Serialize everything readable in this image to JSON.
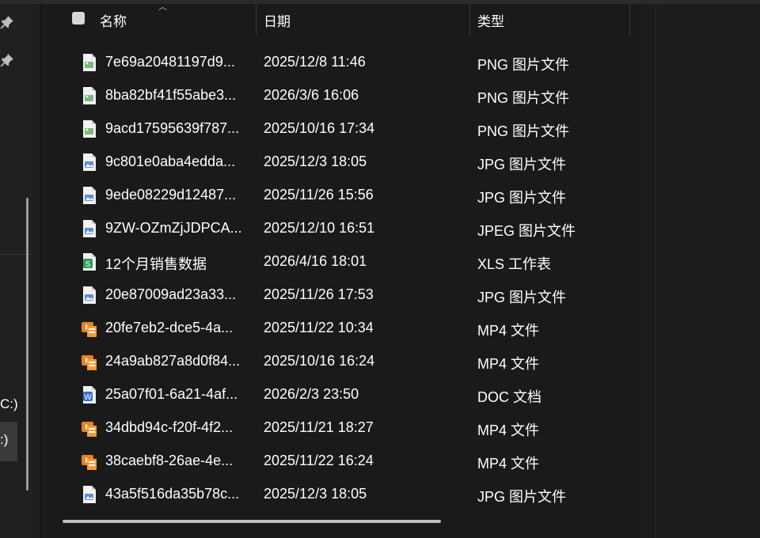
{
  "nav": {
    "pins": [
      "pin-icon",
      "pin-icon"
    ],
    "drives": [
      {
        "label": "C:)"
      },
      {
        "label": ":)"
      }
    ]
  },
  "header": {
    "name": "名称",
    "date": "日期",
    "type": "类型"
  },
  "files": [
    {
      "icon": "png-file-icon",
      "name": "7e69a20481197d9...",
      "date": "2025/12/8 11:46",
      "type": "PNG 图片文件"
    },
    {
      "icon": "png-file-icon",
      "name": "8ba82bf41f55abe3...",
      "date": "2026/3/6 16:06",
      "type": "PNG 图片文件"
    },
    {
      "icon": "png-file-icon",
      "name": "9acd17595639f787...",
      "date": "2025/10/16 17:34",
      "type": "PNG 图片文件"
    },
    {
      "icon": "jpg-file-icon",
      "name": "9c801e0aba4edda...",
      "date": "2025/12/3 18:05",
      "type": "JPG 图片文件"
    },
    {
      "icon": "jpg-file-icon",
      "name": "9ede08229d12487...",
      "date": "2025/11/26 15:56",
      "type": "JPG 图片文件"
    },
    {
      "icon": "jpg-file-icon",
      "name": "9ZW-OZmZjJDPCA...",
      "date": "2025/12/10 16:51",
      "type": "JPEG 图片文件"
    },
    {
      "icon": "xls-file-icon",
      "name": "12个月销售数据",
      "date": "2026/4/16 18:01",
      "type": "XLS 工作表"
    },
    {
      "icon": "jpg-file-icon",
      "name": "20e87009ad23a33...",
      "date": "2025/11/26 17:53",
      "type": "JPG 图片文件"
    },
    {
      "icon": "mp4-file-icon",
      "name": "20fe7eb2-dce5-4a...",
      "date": "2025/11/22 10:34",
      "type": "MP4 文件"
    },
    {
      "icon": "mp4-file-icon",
      "name": "24a9ab827a8d0f84...",
      "date": "2025/10/16 16:24",
      "type": "MP4 文件"
    },
    {
      "icon": "doc-file-icon",
      "name": "25a07f01-6a21-4af...",
      "date": "2026/2/3 23:50",
      "type": "DOC 文档"
    },
    {
      "icon": "mp4-file-icon",
      "name": "34dbd94c-f20f-4f2...",
      "date": "2025/11/21 18:27",
      "type": "MP4 文件"
    },
    {
      "icon": "mp4-file-icon",
      "name": "38caebf8-26ae-4e...",
      "date": "2025/11/22 16:24",
      "type": "MP4 文件"
    },
    {
      "icon": "jpg-file-icon",
      "name": "43a5f516da35b78c...",
      "date": "2025/12/3 18:05",
      "type": "JPG 图片文件"
    }
  ],
  "colors": {
    "background": "#1a1a1a",
    "text": "#ffffff",
    "png_icon": "#7fb77e",
    "jpg_icon": "#5b8fd9",
    "xls_icon": "#2e9b55",
    "mp4_icon": "#e8821e",
    "doc_icon": "#2f6fd6"
  }
}
